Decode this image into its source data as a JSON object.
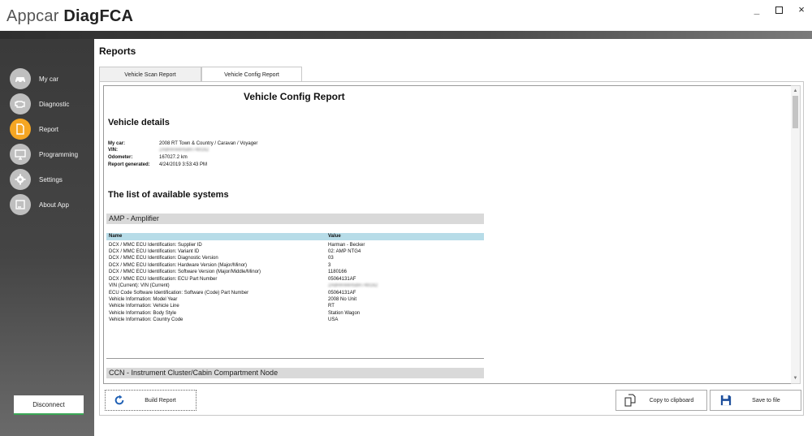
{
  "app": {
    "title_light": "Appcar ",
    "title_bold": "DiagFCA"
  },
  "window_controls": {
    "minimize": "_",
    "close": "×"
  },
  "sidebar": {
    "items": [
      {
        "label": "My car",
        "icon": "car-icon"
      },
      {
        "label": "Diagnostic",
        "icon": "engine-icon"
      },
      {
        "label": "Report",
        "icon": "document-icon",
        "active": true
      },
      {
        "label": "Programming",
        "icon": "monitor-icon"
      },
      {
        "label": "Settings",
        "icon": "gear-icon"
      },
      {
        "label": "About App",
        "icon": "info-icon"
      }
    ],
    "disconnect_label": "Disconnect"
  },
  "main": {
    "heading": "Reports",
    "tabs": [
      {
        "label": "Vehicle Scan Report"
      },
      {
        "label": "Vehicle Config Report",
        "active": true
      }
    ]
  },
  "report": {
    "title": "Vehicle Config Report",
    "vehicle_details_heading": "Vehicle details",
    "details": [
      {
        "key": "My car:",
        "value": "2008 RT Town & Country / Caravan / Voyager"
      },
      {
        "key": "VIN:",
        "value": "2A8HR44H58R749162"
      },
      {
        "key": "Odometer:",
        "value": "167027.2 km"
      },
      {
        "key": "Report generated:",
        "value": "4/24/2019 3:53:43 PM"
      }
    ],
    "systems_heading": "The list of available systems",
    "systems": [
      {
        "name": "AMP - Amplifier",
        "columns": [
          "Name",
          "Value"
        ],
        "rows": [
          [
            "DCX / MMC ECU Identification: Supplier ID",
            "Harman - Becker"
          ],
          [
            "DCX / MMC ECU Identification: Variant ID",
            "02: AMP NTG4"
          ],
          [
            "DCX / MMC ECU Identification: Diagnostic Version",
            "03"
          ],
          [
            "DCX / MMC ECU Identification: Hardware Version (Major/Minor)",
            "3"
          ],
          [
            "DCX / MMC ECU Identification: Software Version (Major/Middle/Minor)",
            "1180166"
          ],
          [
            "DCX / MMC ECU Identification: ECU Part Number",
            "05064131AF"
          ],
          [
            "VIN (Current): VIN (Current)",
            "2A8HR44H58R749162"
          ],
          [
            "ECU Code Software Identification: Software (Code) Part Number",
            "05064131AF"
          ],
          [
            "Vehicle Information: Model Year",
            "2008 No Unit"
          ],
          [
            "Vehicle Information: Vehicle Line",
            "RT"
          ],
          [
            "Vehicle Information: Body Style",
            "Station Wagon"
          ],
          [
            "Vehicle Information: Country Code",
            "USA"
          ]
        ]
      },
      {
        "name": "CCN - Instrument Cluster/Cabin Compartment Node"
      }
    ]
  },
  "actions": {
    "build_report": "Build Report",
    "copy_to_clipboard": "Copy to clipboard",
    "save_to_file": "Save to file"
  },
  "colors": {
    "accent": "#f5a623",
    "table_header": "#b7dce8",
    "section_header": "#d9d9d9",
    "connected": "#3aa655"
  }
}
